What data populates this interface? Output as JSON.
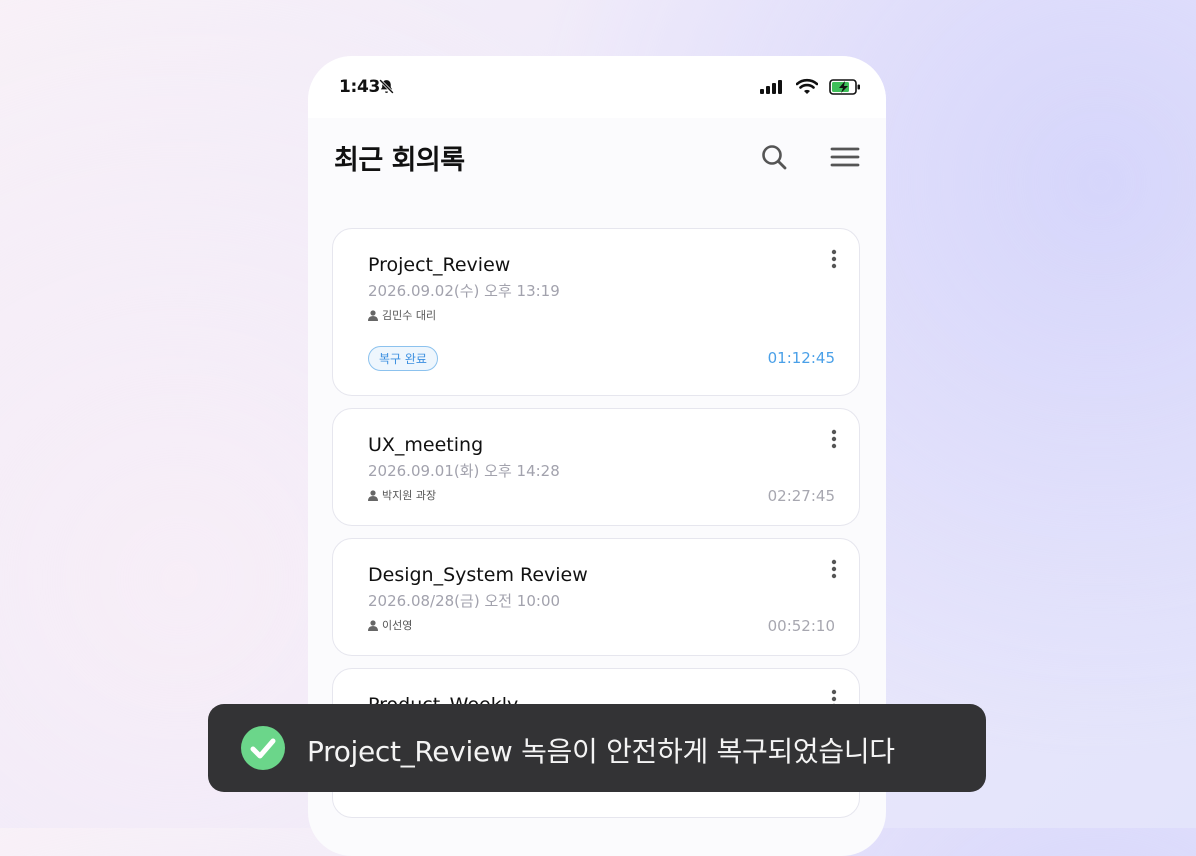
{
  "status_bar": {
    "time": "1:43"
  },
  "header": {
    "title": "최근 회의록"
  },
  "meetings": [
    {
      "title": "Project_Review",
      "date": "2026.09.02(수) 오후 13:19",
      "owner": "김민수 대리",
      "badge": "복구 완료",
      "duration": "01:12:45"
    },
    {
      "title": "UX_meeting",
      "date": "2026.09.01(화) 오후 14:28",
      "owner": "박지원 과장",
      "duration": "02:27:45"
    },
    {
      "title": "Design_System Review",
      "date": "2026.08/28(금) 오전 10:00",
      "owner": "이선영",
      "duration": "00:52:10"
    },
    {
      "title": "Product_Weekly"
    }
  ],
  "toast": {
    "message": "Project_Review 녹음이 안전하게 복구되었습니다"
  },
  "colors": {
    "accent_blue": "#4aa0e8",
    "toast_bg": "#333335",
    "success_green": "#6bd68a",
    "battery_green": "#3fbf5a"
  }
}
